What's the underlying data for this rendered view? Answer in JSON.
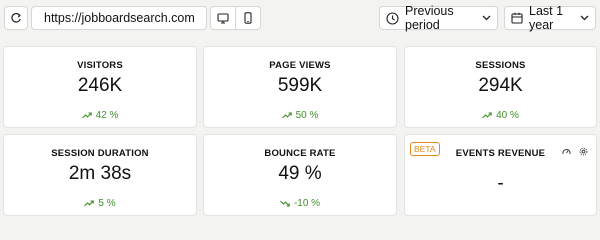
{
  "toolbar": {
    "site": "https://jobboardsearch.com",
    "compare": "Previous period",
    "range": "Last 1 year",
    "icons": [
      "refresh-icon",
      "globe-icon",
      "chevron-down-icon",
      "desktop-icon",
      "mobile-icon",
      "clock-icon",
      "calendar-icon"
    ]
  },
  "metrics": [
    {
      "title": "VISITORS",
      "value": "246K",
      "delta": "42 %",
      "trend": "up"
    },
    {
      "title": "PAGE VIEWS",
      "value": "599K",
      "delta": "50 %",
      "trend": "up"
    },
    {
      "title": "SESSIONS",
      "value": "294K",
      "delta": "40 %",
      "trend": "up"
    },
    {
      "title": "SESSION DURATION",
      "value": "2m 38s",
      "delta": "5 %",
      "trend": "up"
    },
    {
      "title": "BOUNCE RATE",
      "value": "49 %",
      "delta": "-10 %",
      "trend": "down"
    },
    {
      "title": "EVENTS REVENUE",
      "value": "-",
      "badge": "BETA"
    }
  ],
  "colors": {
    "trend": "#3f8f2a",
    "beta": "#e58a1f",
    "background": "#f3f3f1"
  }
}
